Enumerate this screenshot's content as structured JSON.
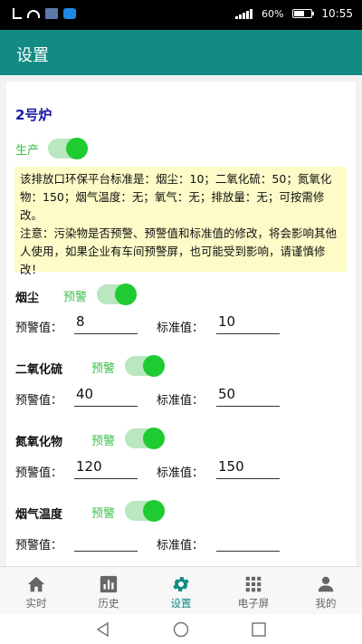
{
  "status_bar": {
    "battery": "60%",
    "time": "10:55"
  },
  "app_bar": {
    "title": "设置"
  },
  "furnace": {
    "name": "2号炉",
    "production_label": "生产",
    "production_on": true
  },
  "notice": {
    "text1": "该排放口环保平台标准是：烟尘：10；二氧化硫：50；氮氧化物：150；烟气温度：无；氧气：无；排放量：无；可按需修改。",
    "text2": "注意：污染物是否预警、预警值和标准值的修改，将会影响其他人使用，如果企业有车间预警屏，也可能受到影响，请谨慎修改！"
  },
  "labels": {
    "warning_toggle": "预警",
    "warning_value": "预警值：",
    "standard_value": "标准值："
  },
  "pollutants": [
    {
      "name": "烟尘",
      "warning_on": true,
      "warning_value": "8",
      "standard_value": "10"
    },
    {
      "name": "二氧化硫",
      "warning_on": true,
      "warning_value": "40",
      "standard_value": "50"
    },
    {
      "name": "氮氧化物",
      "warning_on": true,
      "warning_value": "120",
      "standard_value": "150"
    },
    {
      "name": "烟气温度",
      "warning_on": true,
      "warning_value": "",
      "standard_value": ""
    }
  ],
  "bottom_nav": [
    {
      "label": "实时",
      "icon": "home-icon",
      "active": false
    },
    {
      "label": "历史",
      "icon": "chart-icon",
      "active": false
    },
    {
      "label": "设置",
      "icon": "gear-icon",
      "active": true
    },
    {
      "label": "电子屏",
      "icon": "grid-icon",
      "active": false
    },
    {
      "label": "我的",
      "icon": "person-icon",
      "active": false
    }
  ],
  "colors": {
    "primary": "#128b83",
    "switch_on": "#1ecb30",
    "warning_label": "#3bbf4a",
    "furnace_title": "#1a1aa6",
    "notice_bg": "#fdfbc7"
  }
}
